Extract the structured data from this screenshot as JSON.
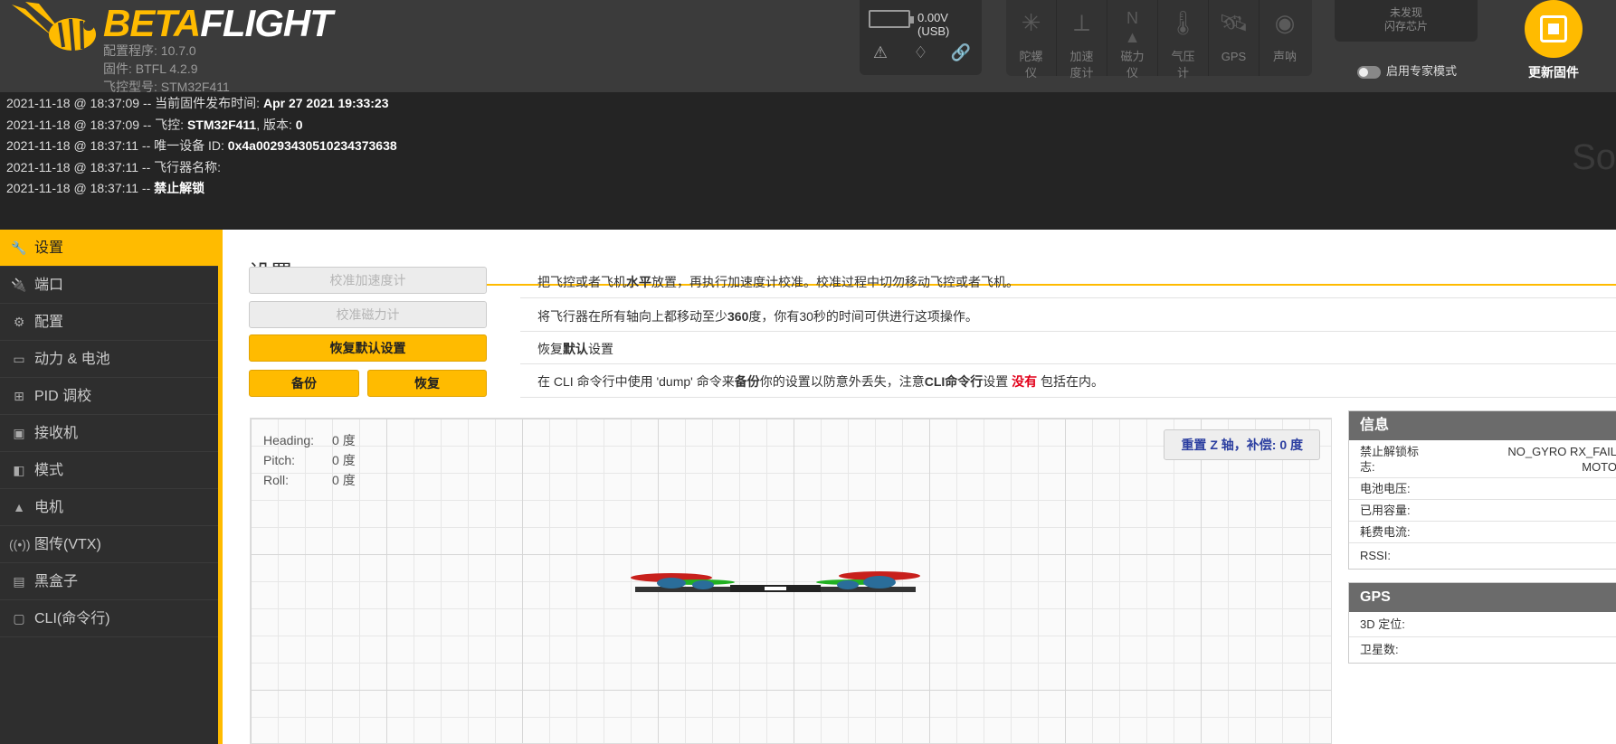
{
  "header": {
    "logo_part1": "BETA",
    "logo_part2": "FLIGHT",
    "config_version": "配置程序: 10.7.0",
    "firmware": "固件: BTFL 4.2.9",
    "fc_model": "飞控型号: STM32F411",
    "battery_voltage": "0.00V (USB)",
    "sensors": [
      {
        "label1": "陀螺",
        "label2": "仪",
        "icon": "gyro-icon"
      },
      {
        "label1": "加速",
        "label2": "度计",
        "icon": "accel-icon"
      },
      {
        "label1": "磁力",
        "label2": "仪",
        "icon": "compass-icon"
      },
      {
        "label1": "气压",
        "label2": "计",
        "icon": "baro-icon"
      },
      {
        "label1": "GPS",
        "label2": "",
        "icon": "gps-icon"
      },
      {
        "label1": "声呐",
        "label2": "",
        "icon": "sonar-icon"
      }
    ],
    "flash_line1": "未发现",
    "flash_line2": "闪存芯片",
    "expert_mode": "启用专家模式",
    "update_firmware": "更新固件"
  },
  "log": [
    {
      "prefix": "2021-11-18 @ 18:37:09 -- 当前固件发布时间: ",
      "value": "Apr 27 2021 19:33:23",
      "suffix": ""
    },
    {
      "prefix": "2021-11-18 @ 18:37:09 -- 飞控: ",
      "value": "STM32F411",
      "suffix": ", 版本: ",
      "value2": "0"
    },
    {
      "prefix": "2021-11-18 @ 18:37:11 -- 唯一设备 ID: ",
      "value": "0x4a00293430510234373638",
      "suffix": ""
    },
    {
      "prefix": "2021-11-18 @ 18:37:11 -- 飞行器名称:",
      "value": "",
      "suffix": ""
    },
    {
      "prefix": "2021-11-18 @ 18:37:11 -- ",
      "value": "禁止解锁",
      "suffix": ""
    }
  ],
  "log_ghost": "So",
  "sidebar": [
    {
      "label": "设置",
      "icon": "wrench-icon",
      "active": true
    },
    {
      "label": "端口",
      "icon": "plug-icon"
    },
    {
      "label": "配置",
      "icon": "gear-icon"
    },
    {
      "label": "动力 & 电池",
      "icon": "battery-icon"
    },
    {
      "label": "PID 调校",
      "icon": "sitemap-icon"
    },
    {
      "label": "接收机",
      "icon": "robot-icon"
    },
    {
      "label": "模式",
      "icon": "toggle-icon"
    },
    {
      "label": "电机",
      "icon": "motor-icon"
    },
    {
      "label": "图传(VTX)",
      "icon": "vtx-icon"
    },
    {
      "label": "黑盒子",
      "icon": "blackbox-icon"
    },
    {
      "label": "CLI(命令行)",
      "icon": "terminal-icon"
    }
  ],
  "main": {
    "title": "设置",
    "calib_acc": "校准加速度计",
    "calib_acc_desc_a": "把飞控或者飞机",
    "calib_acc_desc_b": "水平",
    "calib_acc_desc_c": "放置，再执行加速度计校准。校准过程中切勿移动飞控或者飞机。",
    "calib_mag": "校准磁力计",
    "calib_mag_desc_a": "将飞行器在所有轴向上都移动至少",
    "calib_mag_desc_b": "360",
    "calib_mag_desc_c": "度，你有30秒的时间可供进行这项操作。",
    "reset": "恢复默认设置",
    "reset_desc_a": "恢复",
    "reset_desc_b": "默认",
    "reset_desc_c": "设置",
    "backup": "备份",
    "restore": "恢复",
    "backup_desc_a": "在 CLI 命令行中使用 'dump' 命令来",
    "backup_desc_b": "备份",
    "backup_desc_c": "你的设置以防意外丢失，注意",
    "backup_desc_d": "CLI命令行",
    "backup_desc_e": "设置 ",
    "backup_desc_f": "没有",
    "backup_desc_g": " 包括在内。"
  },
  "attitude": {
    "heading_label": "Heading:",
    "heading_value": "0 度",
    "pitch_label": "Pitch:",
    "pitch_value": "0 度",
    "roll_label": "Roll:",
    "roll_value": "0 度",
    "reset_z": "重置 Z 轴，补偿: 0 度"
  },
  "info": {
    "title": "信息",
    "arming_label": "禁止解锁标志:",
    "arming_label_a": "禁止解锁标",
    "arming_label_b": "志:",
    "arming_value_a": "NO_GYRO  RX_FAIL",
    "arming_value_b": "MOTO",
    "battery_voltage": "电池电压:",
    "capacity_used": "已用容量:",
    "current_draw": "耗费电流:",
    "rssi": "RSSI:"
  },
  "gps": {
    "title": "GPS",
    "fix3d": "3D 定位:",
    "sats": "卫星数:"
  }
}
